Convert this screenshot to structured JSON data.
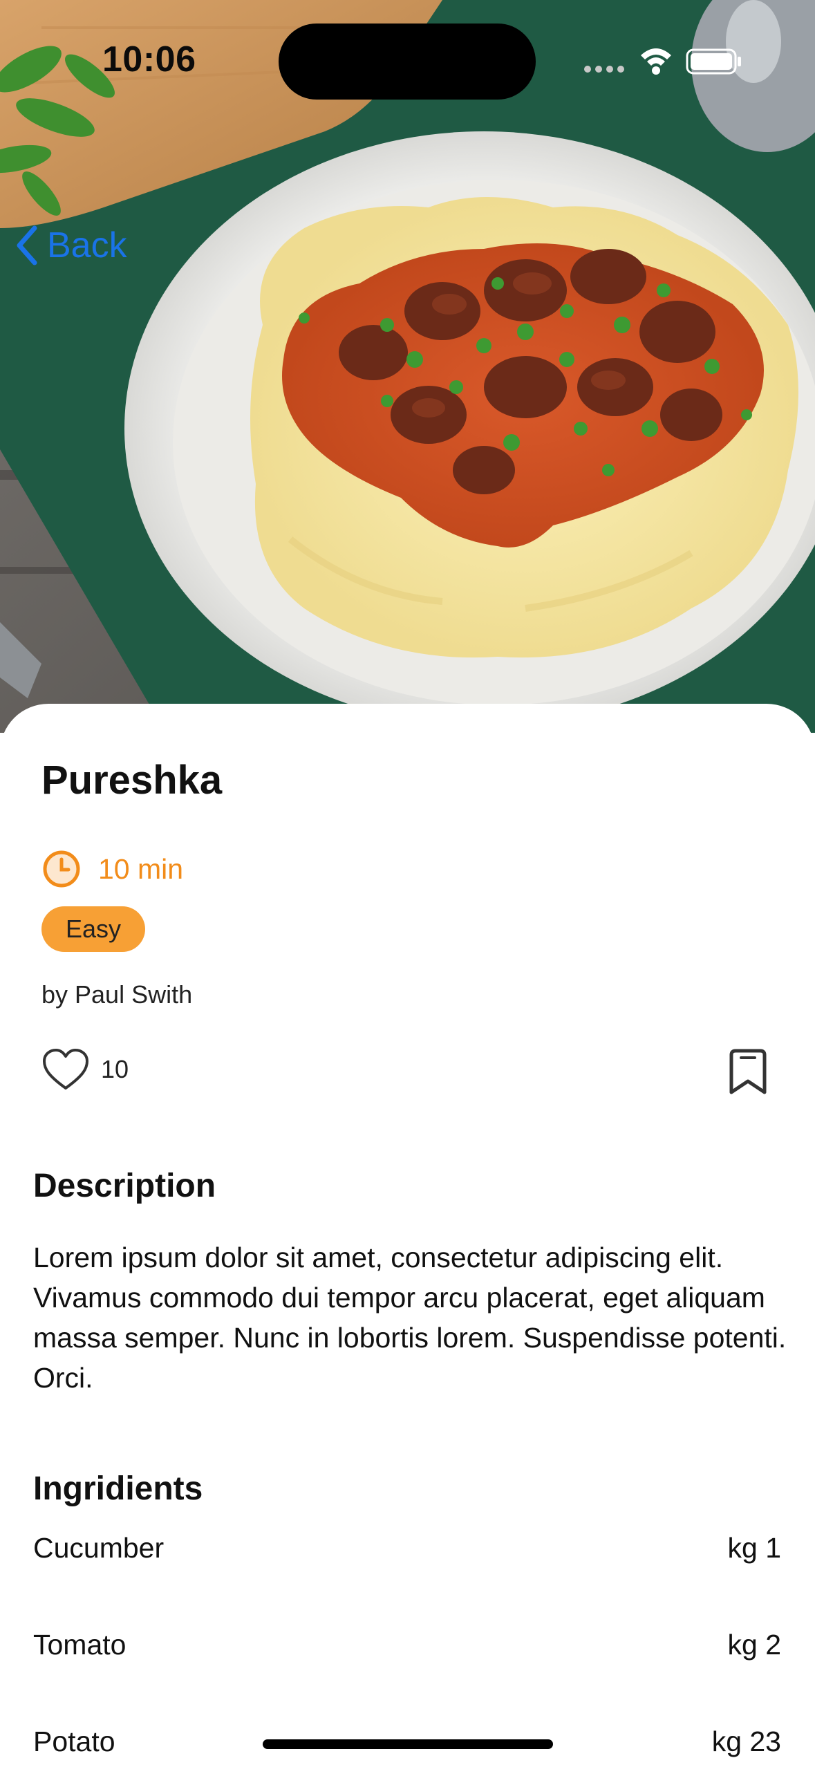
{
  "status_bar": {
    "time": "10:06"
  },
  "nav": {
    "back_label": "Back"
  },
  "recipe": {
    "title": "Pureshka",
    "time": "10 min",
    "difficulty": "Easy",
    "author": "by Paul Swith",
    "likes": "10"
  },
  "description": {
    "heading": "Description",
    "text": "Lorem ipsum dolor sit amet, consectetur adipiscing elit. Vivamus commodo dui tempor arcu placerat, eget aliquam massa semper. Nunc in lobortis lorem. Suspendisse potenti. Orci."
  },
  "ingredients": {
    "heading": "Ingridients",
    "items": [
      {
        "name": "Cucumber",
        "amount": "kg 1"
      },
      {
        "name": "Tomato",
        "amount": "kg 2"
      },
      {
        "name": "Potato",
        "amount": "kg 23"
      }
    ]
  },
  "icons": {
    "back": "chevron-left-icon",
    "clock": "clock-icon",
    "heart": "heart-icon",
    "bookmark": "bookmark-icon",
    "wifi": "wifi-icon",
    "battery": "battery-icon"
  },
  "colors": {
    "accent_orange": "#f28c1a",
    "badge_orange": "#f7a035",
    "link_blue": "#1a73e8"
  }
}
